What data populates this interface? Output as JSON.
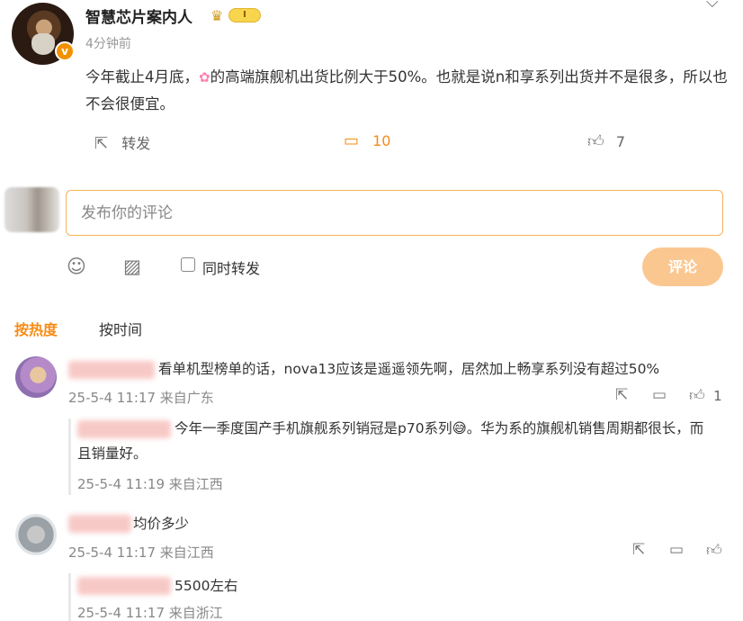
{
  "post": {
    "author": "智慧芯片案内人",
    "level_badge": "I",
    "verified_badge": "v",
    "time": "4分钟前",
    "text_before_icon": "今年截止4月底，",
    "text_after_icon": "的高端旗舰机出货比例大于50%。也就是说n和享系列出货并不是很多，所以也不会很便宜。",
    "actions": {
      "repost_label": "转发",
      "comment_count": "10",
      "like_count": "7"
    }
  },
  "composer": {
    "placeholder": "发布你的评论",
    "repost_checkbox_label": "同时转发",
    "submit_label": "评论"
  },
  "sort_tabs": {
    "hot": "按热度",
    "time": "按时间"
  },
  "comments": [
    {
      "text": "看单机型榜单的话，nova13应该是遥遥领先啊，居然加上畅享系列没有超过50%",
      "meta": "25-5-4 11:17 来自广东",
      "like_count": "1",
      "reply": {
        "text_before_emoji": "今年一季度国产手机旗舰系列销冠是p70系列",
        "emoji": "😅",
        "text_after_emoji": "。华为系的旗舰机销售周期都很长，而且销量好。",
        "meta": "25-5-4 11:19 来自江西"
      }
    },
    {
      "text": "均价多少",
      "meta": "25-5-4 11:17 来自江西",
      "like_count": "",
      "reply": {
        "text": "5500左右",
        "meta": "25-5-4 11:17 来自浙江"
      }
    }
  ],
  "colors": {
    "accent": "#f78b15",
    "submit_disabled": "#fbc791",
    "input_border": "#f5b45a",
    "meta_gray": "#888888"
  }
}
